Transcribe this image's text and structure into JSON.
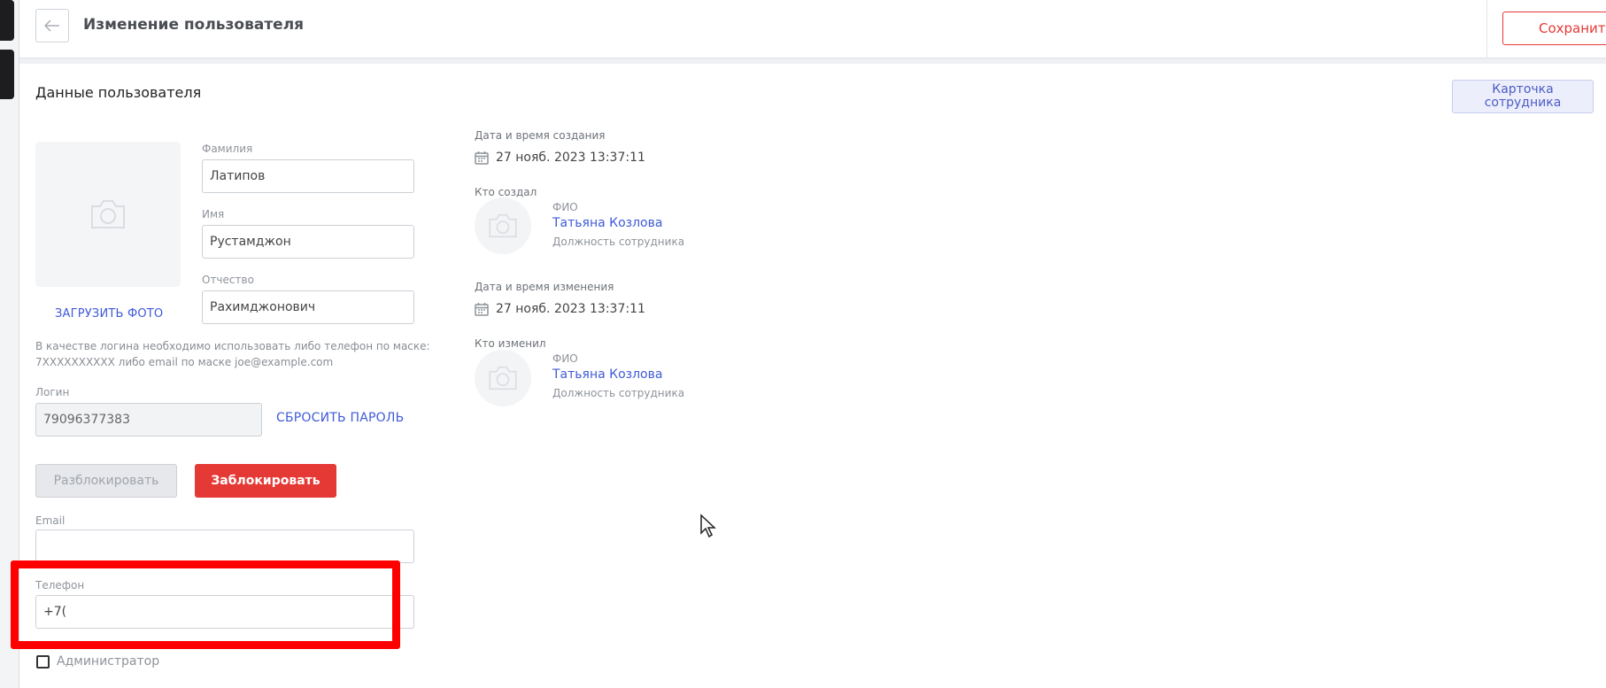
{
  "header": {
    "title": "Изменение пользователя",
    "save_label": "Сохранить"
  },
  "section": {
    "title": "Данные пользователя",
    "employee_card_label": "Карточка сотрудника"
  },
  "photo": {
    "upload_label": "ЗАГРУЗИТЬ ФОТО"
  },
  "fields": {
    "last_name": {
      "label": "Фамилия",
      "value": "Латипов"
    },
    "first_name": {
      "label": "Имя",
      "value": "Рустамджон"
    },
    "patronymic": {
      "label": "Отчество",
      "value": "Рахимджонович"
    },
    "login_hint": "В качестве логина необходимо использовать либо телефон по маске: 7XXXXXXXXXX либо email по маске joe@example.com",
    "login": {
      "label": "Логин",
      "value": "79096377383"
    },
    "reset_password_label": "СБРОСИТЬ ПАРОЛЬ",
    "email": {
      "label": "Email",
      "value": ""
    },
    "phone": {
      "label": "Телефон",
      "value": "+7("
    },
    "admin_label": "Администратор"
  },
  "actions": {
    "unblock_label": "Разблокировать",
    "block_label": "Заблокировать"
  },
  "meta": {
    "created": {
      "date_label": "Дата и время создания",
      "date_value": "27 нояб. 2023 13:37:11",
      "by_label": "Кто создал",
      "fio_label": "ФИО",
      "name": "Татьяна Козлова",
      "position": "Должность сотрудника"
    },
    "modified": {
      "date_label": "Дата и время изменения",
      "date_value": "27 нояб. 2023 13:37:11",
      "by_label": "Кто изменил",
      "fio_label": "ФИО",
      "name": "Татьяна Козлова",
      "position": "Должность сотрудника"
    }
  },
  "colors": {
    "accent_red": "#e53935",
    "link_blue": "#3f5ad8",
    "highlight_red": "#ff0000"
  },
  "icons": [
    "arrow-left-icon",
    "camera-icon",
    "calendar-icon",
    "cursor-icon"
  ]
}
